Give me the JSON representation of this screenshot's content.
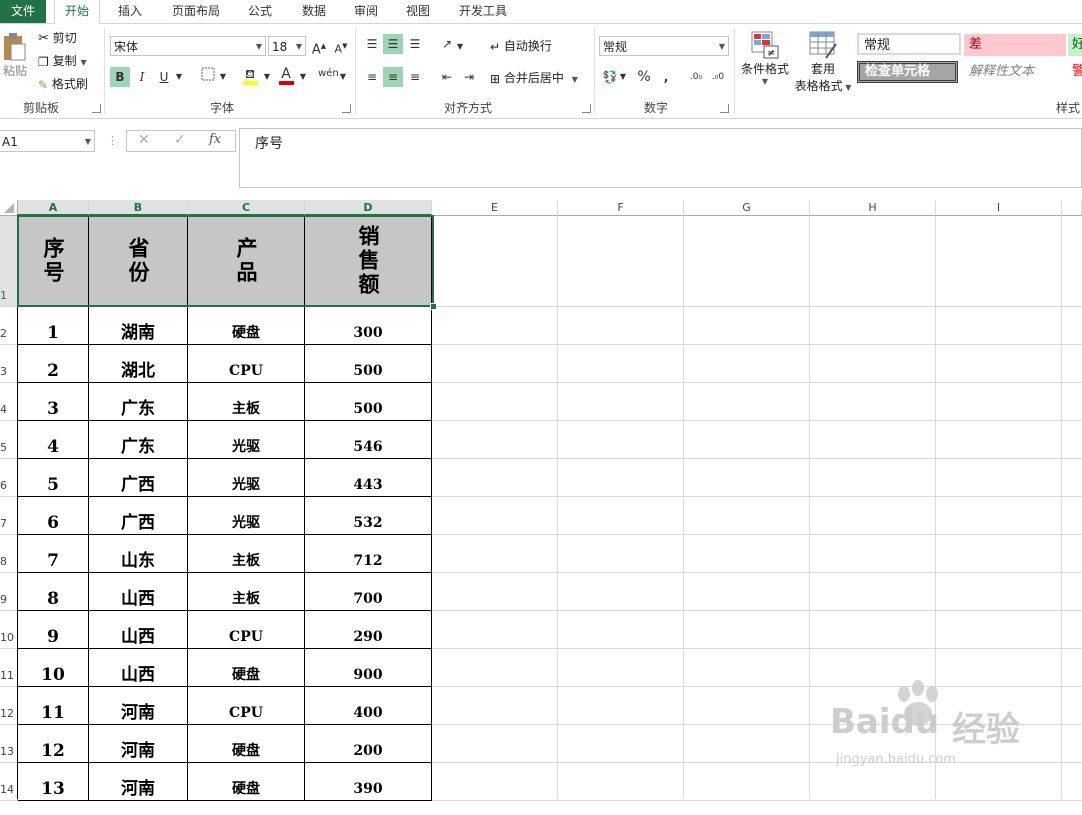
{
  "tabs": [
    "文件",
    "开始",
    "插入",
    "页面布局",
    "公式",
    "数据",
    "审阅",
    "视图",
    "开发工具"
  ],
  "clipboard": {
    "paste": "粘贴",
    "cut": "剪切",
    "copy": "复制",
    "format_painter": "格式刷",
    "group": "剪贴板"
  },
  "font": {
    "name": "宋体",
    "size": "18",
    "group": "字体",
    "bold": "B",
    "italic": "I",
    "underline": "U"
  },
  "alignment": {
    "wrap": "自动换行",
    "merge": "合并后居中",
    "group": "对齐方式"
  },
  "number": {
    "format": "常规",
    "group": "数字"
  },
  "styles": {
    "conditional": "条件格式",
    "table_format_1": "套用",
    "table_format_2": "表格格式",
    "normal": "常规",
    "bad": "差",
    "check": "检查单元格",
    "explain": "解释性文本",
    "good_partial": "好",
    "warn_partial": "警",
    "group": "样式"
  },
  "formula_bar": {
    "name_box": "A1",
    "fx": "fx",
    "content": "序号"
  },
  "columns": [
    "A",
    "B",
    "C",
    "D",
    "E",
    "F",
    "G",
    "H",
    "I"
  ],
  "header_row": [
    "序号",
    "省份",
    "产品",
    "销售额"
  ],
  "rows": [
    [
      "1",
      "湖南",
      "硬盘",
      "300"
    ],
    [
      "2",
      "湖北",
      "CPU",
      "500"
    ],
    [
      "3",
      "广东",
      "主板",
      "500"
    ],
    [
      "4",
      "广东",
      "光驱",
      "546"
    ],
    [
      "5",
      "广西",
      "光驱",
      "443"
    ],
    [
      "6",
      "广西",
      "光驱",
      "532"
    ],
    [
      "7",
      "山东",
      "主板",
      "712"
    ],
    [
      "8",
      "山西",
      "主板",
      "700"
    ],
    [
      "9",
      "山西",
      "CPU",
      "290"
    ],
    [
      "10",
      "山西",
      "硬盘",
      "900"
    ],
    [
      "11",
      "河南",
      "CPU",
      "400"
    ],
    [
      "12",
      "河南",
      "硬盘",
      "200"
    ],
    [
      "13",
      "河南",
      "硬盘",
      "390"
    ]
  ],
  "row_numbers": [
    "1",
    "2",
    "3",
    "4",
    "5",
    "6",
    "7",
    "8",
    "9",
    "10",
    "11",
    "12",
    "13",
    "14"
  ],
  "watermark": {
    "brand": "Baidu",
    "text": "经验",
    "url": "jingyan.baidu.com"
  },
  "colors": {
    "accent": "#217346",
    "header_fill": "#c6c6c6",
    "bad_fill": "#ffc7ce",
    "good_fill": "#c6efce"
  }
}
